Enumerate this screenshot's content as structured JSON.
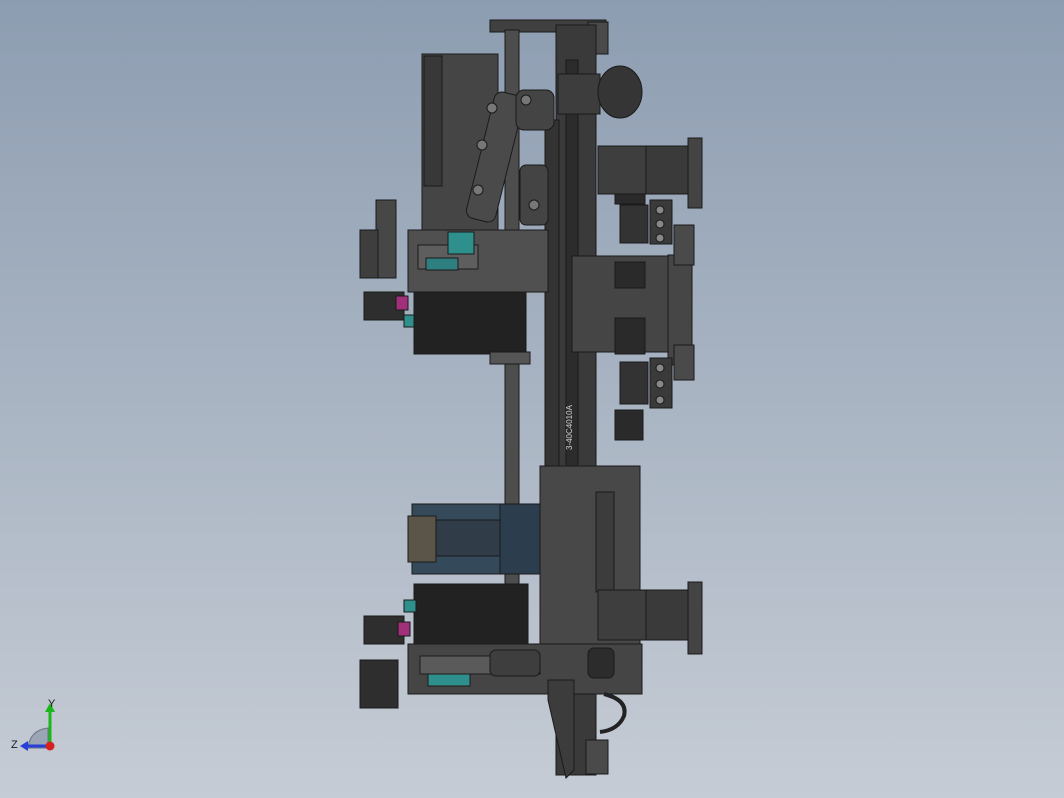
{
  "viewport": {
    "background_top": "#8d9db1",
    "background_bottom": "#c6ccd5",
    "part_color": "#3c3c3c",
    "accent_teal": "#2f8f8c",
    "accent_magenta": "#a0307a",
    "motor_blue": "#34495a"
  },
  "model": {
    "part_label": "3-40C4010A"
  },
  "triad": {
    "y_label": "Y",
    "z_label": "Z",
    "y_color": "#18b818",
    "z_color": "#2840d8",
    "x_color": "#d82020"
  }
}
